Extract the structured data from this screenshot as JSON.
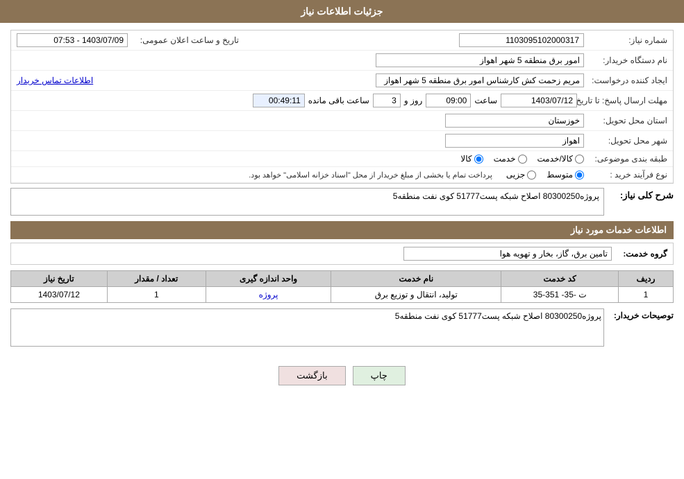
{
  "page": {
    "title": "جزئیات اطلاعات نیاز"
  },
  "header": {
    "title": "جزئیات اطلاعات نیاز"
  },
  "fields": {
    "need_number_label": "شماره نیاز:",
    "need_number_value": "1103095102000317",
    "announcement_date_label": "تاریخ و ساعت اعلان عمومی:",
    "announcement_date_value": "1403/07/09 - 07:53",
    "buyer_station_label": "نام دستگاه خریدار:",
    "buyer_station_value": "امور برق منطقه 5 شهر اهواز",
    "creator_label": "ایجاد کننده درخواست:",
    "creator_value": "مریم زحمت کش کارشناس امور برق منطقه 5 شهر اهواز",
    "contact_info_link": "اطلاعات تماس خریدار",
    "deadline_label": "مهلت ارسال پاسخ: تا تاریخ:",
    "deadline_date": "1403/07/12",
    "deadline_time_label": "ساعت",
    "deadline_time": "09:00",
    "deadline_days_label": "روز و",
    "deadline_days": "3",
    "deadline_remaining_label": "ساعت باقی مانده",
    "deadline_remaining": "00:49:11",
    "province_label": "استان محل تحویل:",
    "province_value": "خوزستان",
    "city_label": "شهر محل تحویل:",
    "city_value": "اهواز",
    "category_label": "طبقه بندی موضوعی:",
    "category_options": [
      "کالا",
      "خدمت",
      "کالا/خدمت"
    ],
    "category_selected": "کالا",
    "purchase_type_label": "نوع فرآیند خرید :",
    "purchase_type_options": [
      "جزیی",
      "متوسط"
    ],
    "purchase_type_selected": "متوسط",
    "purchase_type_note": "پرداخت تمام یا بخشی از مبلغ خریدار از محل \"اسناد خزانه اسلامی\" خواهد بود.",
    "need_description_label": "شرح کلی نیاز:",
    "need_description_value": "پروژه80300250 اصلاح شبکه پست51777 کوی نفت منطقه5",
    "service_info_title": "اطلاعات خدمات مورد نیاز",
    "service_group_label": "گروه خدمت:",
    "service_group_value": "تامین برق، گاز، بخار و تهویه هوا",
    "table": {
      "headers": [
        "ردیف",
        "کد خدمت",
        "نام خدمت",
        "واحد اندازه گیری",
        "تعداد / مقدار",
        "تاریخ نیاز"
      ],
      "rows": [
        {
          "row": "1",
          "code": "ت -35- 351-35",
          "name": "تولید، انتقال و توزیع برق",
          "unit": "پروژه",
          "qty": "1",
          "date": "1403/07/12"
        }
      ]
    },
    "buyer_notes_label": "توصیحات خریدار:",
    "buyer_notes_value": "پروژه80300250 اصلاح شبکه پست51777 کوی نفت منطقه5"
  },
  "buttons": {
    "print": "چاپ",
    "back": "بازگشت"
  }
}
